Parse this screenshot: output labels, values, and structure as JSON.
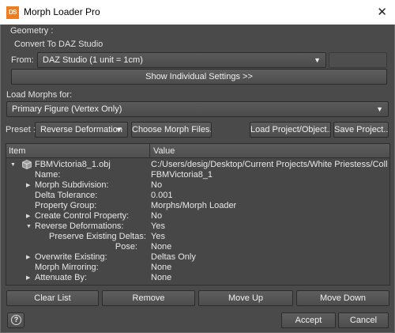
{
  "window": {
    "logo_text": "DS",
    "title": "Morph Loader Pro",
    "close_glyph": "✕"
  },
  "geometry": {
    "label": "Geometry :",
    "convert": "Convert To DAZ Studio",
    "from_label": "From:",
    "from_value": "DAZ Studio (1 unit = 1cm)",
    "extra_button": "",
    "show_settings": "Show Individual Settings >>"
  },
  "load_for": {
    "label": "Load Morphs for:",
    "value": "Primary Figure (Vertex Only)"
  },
  "toolbar": {
    "preset_label": "Preset :",
    "preset_value": "Reverse Deformation",
    "choose_files": "Choose Morph Files...",
    "load_project": "Load Project/Object...",
    "save_project": "Save Project..."
  },
  "tree": {
    "headers": {
      "item": "Item",
      "value": "Value"
    },
    "rows": [
      {
        "key": "FBMVictoria8_1.obj",
        "value": "C:/Users/desig/Desktop/Current Projects/White Priestess/Collar/FB..."
      },
      {
        "key": "Name:",
        "value": "FBMVictoria8_1"
      },
      {
        "key": "Morph Subdivision:",
        "value": "No"
      },
      {
        "key": "Delta Tolerance:",
        "value": "0.001"
      },
      {
        "key": "Property Group:",
        "value": "Morphs/Morph Loader"
      },
      {
        "key": "Create Control Property:",
        "value": "No"
      },
      {
        "key": "Reverse Deformations:",
        "value": "Yes"
      },
      {
        "key": "Preserve Existing Deltas:",
        "value": "Yes"
      },
      {
        "key": "Pose:",
        "value": "None"
      },
      {
        "key": "Overwrite Existing:",
        "value": "Deltas Only"
      },
      {
        "key": "Morph Mirroring:",
        "value": "None"
      },
      {
        "key": "Attenuate By:",
        "value": "None"
      }
    ]
  },
  "list_buttons": {
    "clear": "Clear List",
    "remove": "Remove",
    "move_up": "Move Up",
    "move_down": "Move Down"
  },
  "dialog_buttons": {
    "help": "?",
    "accept": "Accept",
    "cancel": "Cancel"
  },
  "colors": {
    "background": "#4a4a4a",
    "logo": "#ee7d1f",
    "text": "#e4e4e4"
  }
}
